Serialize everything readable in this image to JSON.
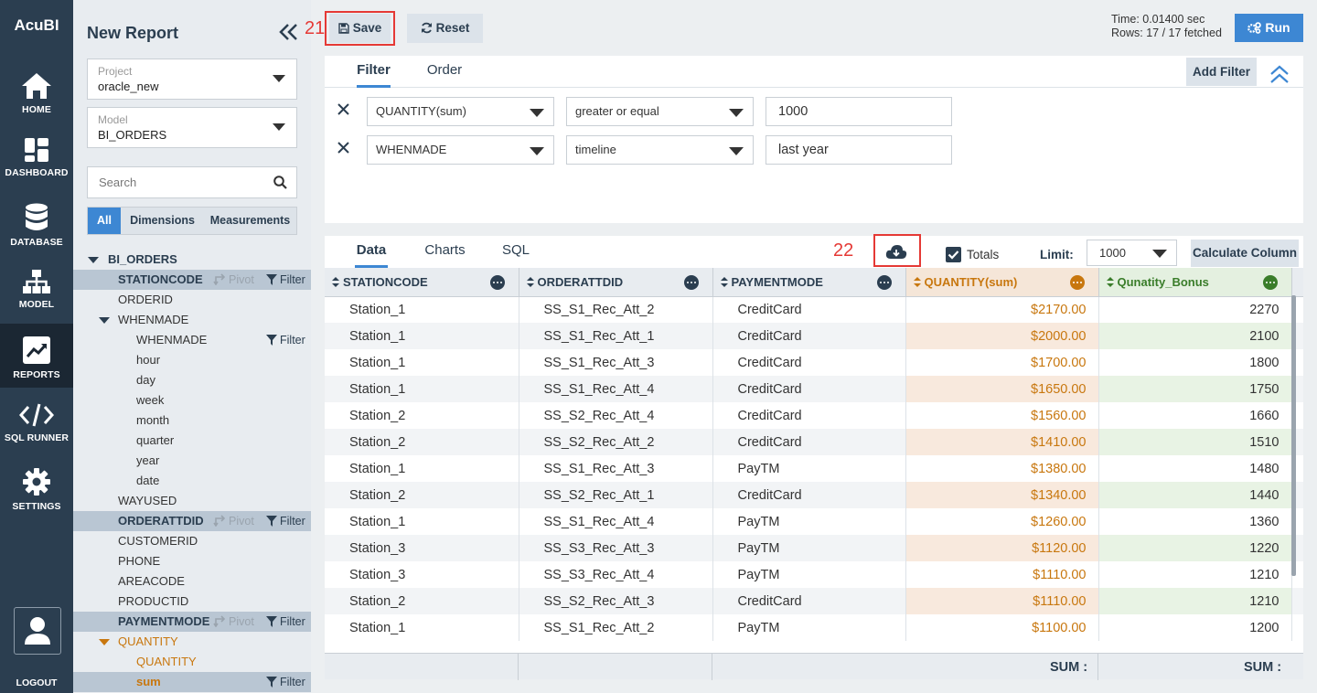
{
  "app": {
    "brand": "AcuBI"
  },
  "nav": {
    "items": [
      {
        "label": "HOME",
        "icon": "home-icon"
      },
      {
        "label": "DASHBOARD",
        "icon": "dashboard-icon"
      },
      {
        "label": "DATABASE",
        "icon": "database-icon"
      },
      {
        "label": "MODEL",
        "icon": "model-icon"
      },
      {
        "label": "REPORTS",
        "icon": "reports-icon"
      },
      {
        "label": "SQL RUNNER",
        "icon": "code-icon"
      },
      {
        "label": "SETTINGS",
        "icon": "gear-icon"
      }
    ],
    "logout": "LOGOUT"
  },
  "sidebar": {
    "title": "New Report",
    "project": {
      "label": "Project",
      "value": "oracle_new"
    },
    "model": {
      "label": "Model",
      "value": "BI_ORDERS"
    },
    "search_placeholder": "Search",
    "segments": [
      "All",
      "Dimensions",
      "Measurements"
    ],
    "tree": [
      {
        "label": "BI_ORDERS"
      },
      {
        "label": "STATIONCODE",
        "pivot": "Pivot",
        "filter": "Filter"
      },
      {
        "label": "ORDERID"
      },
      {
        "label": "WHENMADE"
      },
      {
        "label": "WHENMADE",
        "filter": "Filter"
      },
      {
        "label": "hour"
      },
      {
        "label": "day"
      },
      {
        "label": "week"
      },
      {
        "label": "month"
      },
      {
        "label": "quarter"
      },
      {
        "label": "year"
      },
      {
        "label": "date"
      },
      {
        "label": "WAYUSED"
      },
      {
        "label": "ORDERATTDID",
        "pivot": "Pivot",
        "filter": "Filter"
      },
      {
        "label": "CUSTOMERID"
      },
      {
        "label": "PHONE"
      },
      {
        "label": "AREACODE"
      },
      {
        "label": "PRODUCTID"
      },
      {
        "label": "PAYMENTMODE",
        "pivot": "Pivot",
        "filter": "Filter"
      },
      {
        "label": "QUANTITY"
      },
      {
        "label": "QUANTITY"
      },
      {
        "label": "sum",
        "filter": "Filter"
      }
    ]
  },
  "toolbar": {
    "save_label": "Save",
    "save_annotation": "21",
    "reset_label": "Reset",
    "time_text": "Time: 0.01400 sec",
    "rows_text": "Rows: 17 / 17 fetched",
    "run_label": "Run"
  },
  "filter_panel": {
    "tabs": [
      "Filter",
      "Order"
    ],
    "add_filter_label": "Add Filter",
    "filters": [
      {
        "field": "QUANTITY(sum)",
        "operator": "greater or equal",
        "value": "1000"
      },
      {
        "field": "WHENMADE",
        "operator": "timeline",
        "value": "last year"
      }
    ]
  },
  "data_panel": {
    "tabs": [
      "Data",
      "Charts",
      "SQL"
    ],
    "download_annotation": "22",
    "totals_label": "Totals",
    "totals_checked": true,
    "limit_label": "Limit:",
    "limit_value": "1000",
    "calc_label": "Calculate Column",
    "columns": [
      "STATIONCODE",
      "ORDERATTDID",
      "PAYMENTMODE",
      "QUANTITY(sum)",
      "Qunatity_Bonus"
    ],
    "rows": [
      [
        "Station_1",
        "SS_S1_Rec_Att_2",
        "CreditCard",
        "$2170.00",
        "2270"
      ],
      [
        "Station_1",
        "SS_S1_Rec_Att_1",
        "CreditCard",
        "$2000.00",
        "2100"
      ],
      [
        "Station_1",
        "SS_S1_Rec_Att_3",
        "CreditCard",
        "$1700.00",
        "1800"
      ],
      [
        "Station_1",
        "SS_S1_Rec_Att_4",
        "CreditCard",
        "$1650.00",
        "1750"
      ],
      [
        "Station_2",
        "SS_S2_Rec_Att_4",
        "CreditCard",
        "$1560.00",
        "1660"
      ],
      [
        "Station_2",
        "SS_S2_Rec_Att_2",
        "CreditCard",
        "$1410.00",
        "1510"
      ],
      [
        "Station_1",
        "SS_S1_Rec_Att_3",
        "PayTM",
        "$1380.00",
        "1480"
      ],
      [
        "Station_2",
        "SS_S2_Rec_Att_1",
        "CreditCard",
        "$1340.00",
        "1440"
      ],
      [
        "Station_1",
        "SS_S1_Rec_Att_4",
        "PayTM",
        "$1260.00",
        "1360"
      ],
      [
        "Station_3",
        "SS_S3_Rec_Att_3",
        "PayTM",
        "$1120.00",
        "1220"
      ],
      [
        "Station_3",
        "SS_S3_Rec_Att_4",
        "PayTM",
        "$1110.00",
        "1210"
      ],
      [
        "Station_2",
        "SS_S2_Rec_Att_3",
        "CreditCard",
        "$1110.00",
        "1210"
      ],
      [
        "Station_1",
        "SS_S1_Rec_Att_2",
        "PayTM",
        "$1100.00",
        "1200"
      ]
    ],
    "sum_label": "SUM :",
    "colors": {
      "measure": "#c8770e",
      "custom": "#3a7d2a",
      "accent": "#3d87d3"
    }
  }
}
